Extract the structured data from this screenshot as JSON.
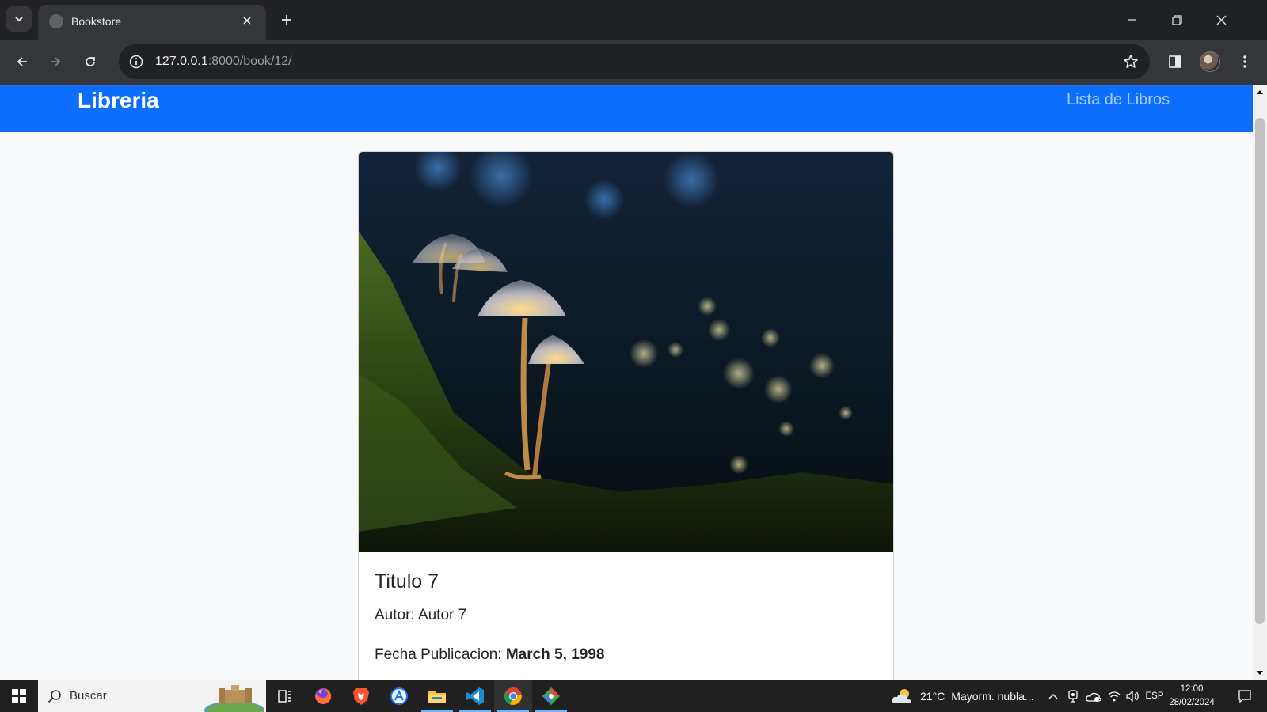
{
  "browser": {
    "tab_title": "Bookstore",
    "url_host": "127.0.0.1",
    "url_path": ":8000/book/12/"
  },
  "page": {
    "brand": "Libreria",
    "nav_link": "Lista de Libros",
    "book": {
      "title": "Titulo 7",
      "author_label": "Autor:",
      "author": "Autor 7",
      "date_label": "Fecha Publicacion:",
      "date": "March 5, 1998"
    }
  },
  "taskbar": {
    "search_placeholder": "Buscar",
    "weather_temp": "21°C",
    "weather_desc": "Mayorm. nubla...",
    "language": "ESP",
    "time": "12:00",
    "date": "28/02/2024"
  },
  "colors": {
    "navbar": "#0d6efd",
    "btn_primary": "#0d6efd",
    "btn_danger": "#dc3545",
    "chrome_dark": "#202124"
  }
}
